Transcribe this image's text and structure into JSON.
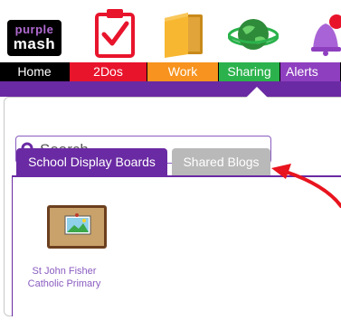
{
  "brand": {
    "line1": "purple",
    "line2": "mash"
  },
  "nav": {
    "items": [
      {
        "label": "Home"
      },
      {
        "label": "2Dos"
      },
      {
        "label": "Work"
      },
      {
        "label": "Sharing"
      },
      {
        "label": "Alerts"
      }
    ],
    "active": "Sharing",
    "colors": {
      "home": "#000000",
      "todos": "#e8142c",
      "work": "#f7931e",
      "sharing": "#2bb24c",
      "alerts": "#8e3fbf"
    }
  },
  "icons": [
    "clipboard-check-icon",
    "folder-icon",
    "globe-icon",
    "bell-icon",
    "search-icon",
    "picture-frame-icon"
  ],
  "search": {
    "placeholder": "Search"
  },
  "tabs": [
    {
      "label": "School Display Boards",
      "active": true
    },
    {
      "label": "Shared Blogs",
      "active": false
    }
  ],
  "boards": [
    {
      "name": "St John Fisher Catholic Primary"
    }
  ],
  "accent_color": "#6a2aa3",
  "annotation_color": "#e8141e"
}
